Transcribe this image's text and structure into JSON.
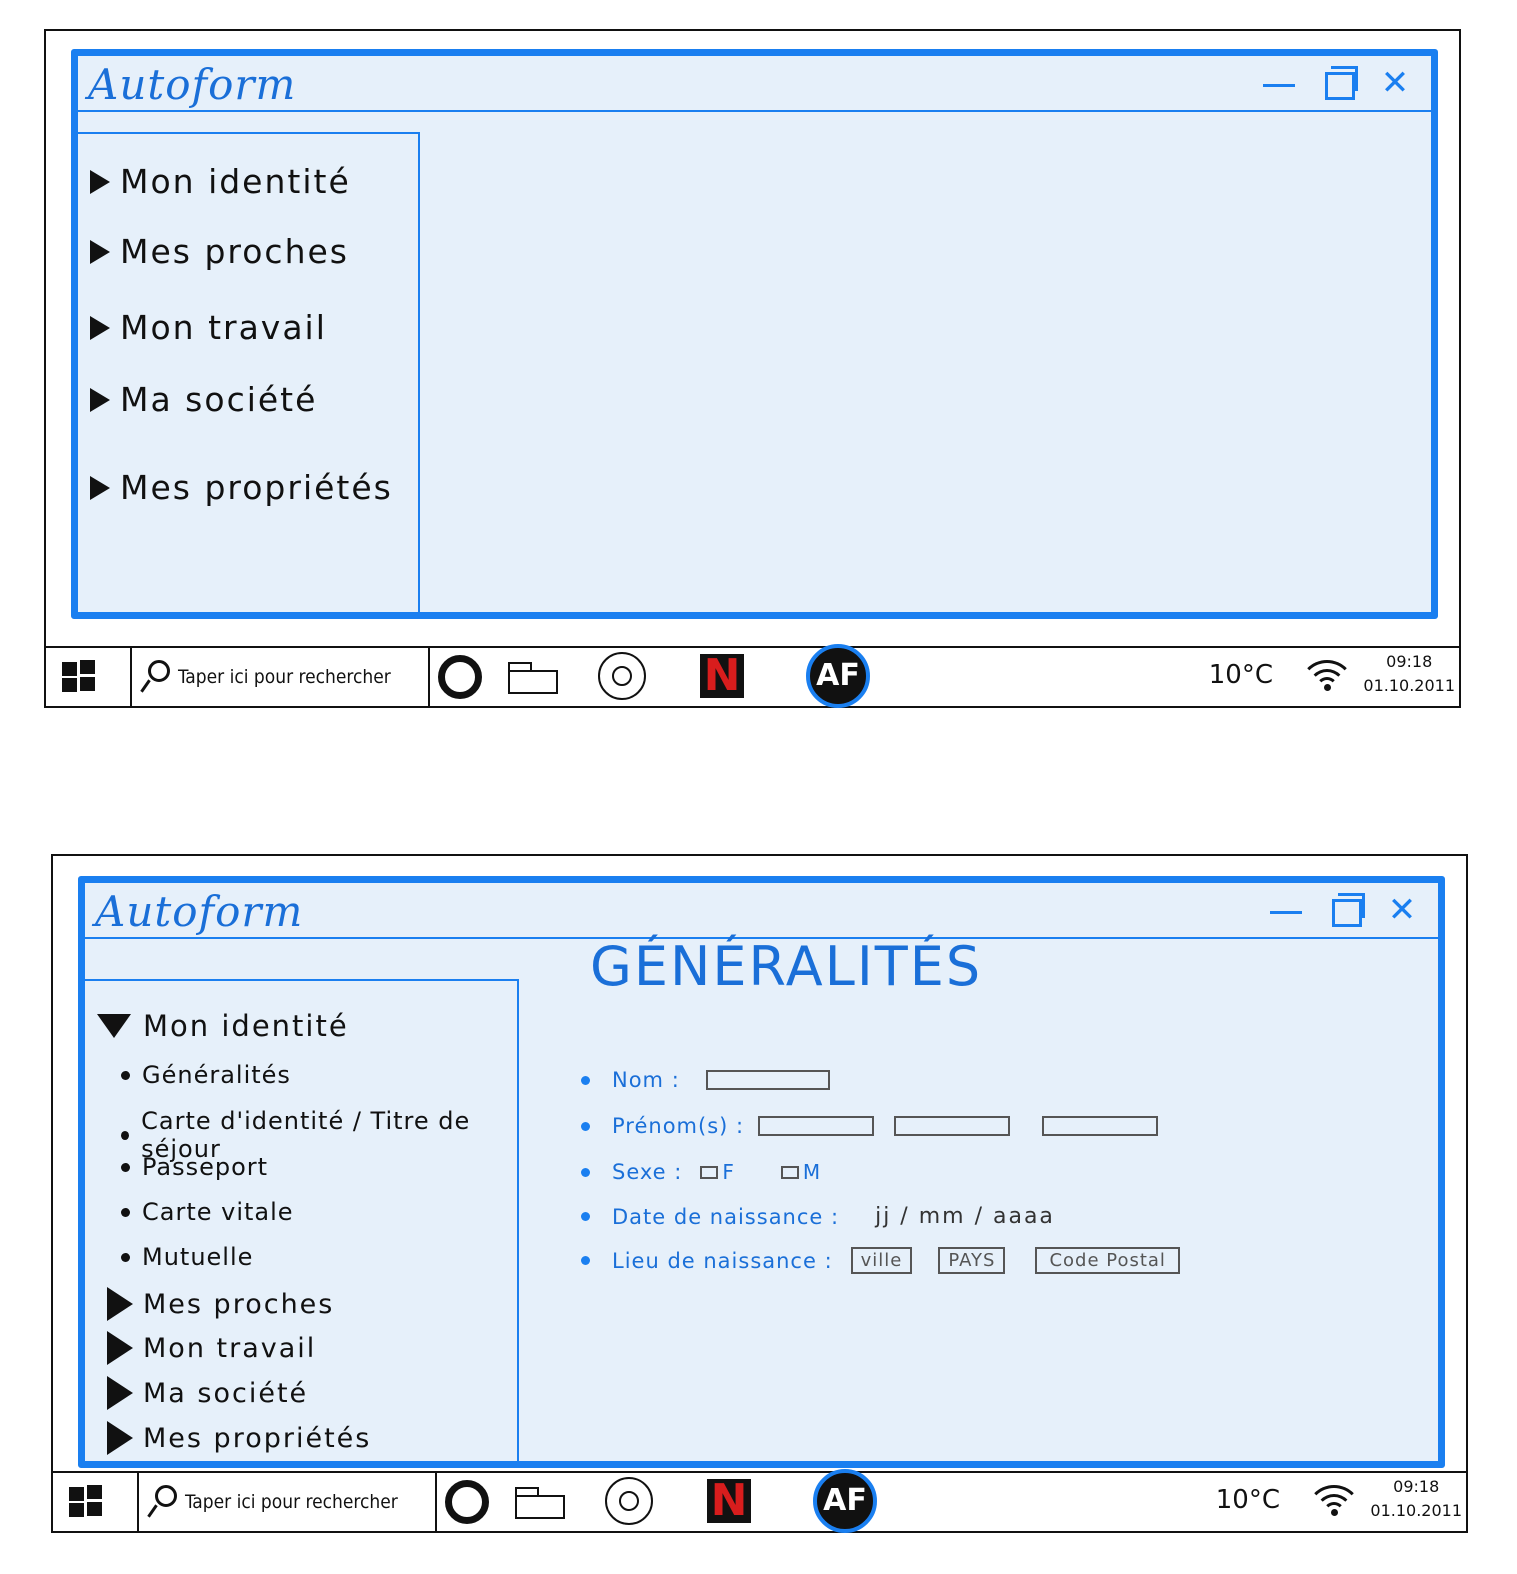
{
  "app_title": "Autoform",
  "taskbar": {
    "search_placeholder": "Taper ici pour rechercher",
    "temperature": "10°C",
    "time": "09:18",
    "date": "01.10.2011",
    "netflix_letter": "N",
    "autoform_logo": "AF"
  },
  "window_controls": {
    "minimize": "minimize-icon",
    "maximize": "maximize-icon",
    "close": "✕"
  },
  "screen1": {
    "nav": [
      "Mon identité",
      "Mes proches",
      "Mon travail",
      "Ma société",
      "Mes propriétés"
    ]
  },
  "screen2": {
    "section_title": "GÉNÉRALITÉS",
    "expanded": {
      "label": "Mon identité",
      "subitems": [
        "Généralités",
        "Carte d'identité / Titre de séjour",
        "Passeport",
        "Carte vitale",
        "Mutuelle"
      ]
    },
    "nav": [
      "Mes proches",
      "Mon travail",
      "Ma société",
      "Mes propriétés"
    ],
    "form": {
      "nom_label": "Nom :",
      "prenom_label": "Prénom(s) :",
      "sexe_label": "Sexe :",
      "sexe_f": "F",
      "sexe_m": "M",
      "naissance_label": "Date de naissance :",
      "date_format": "jj / mm / aaaa",
      "lieu_label": "Lieu de naissance :",
      "ville": "ville",
      "pays": "PAYS",
      "code_postal": "Code Postal"
    }
  },
  "colors": {
    "accent": "#1a7ff0",
    "window_bg": "#e6f0fa",
    "netflix_red": "#d81d1d"
  }
}
